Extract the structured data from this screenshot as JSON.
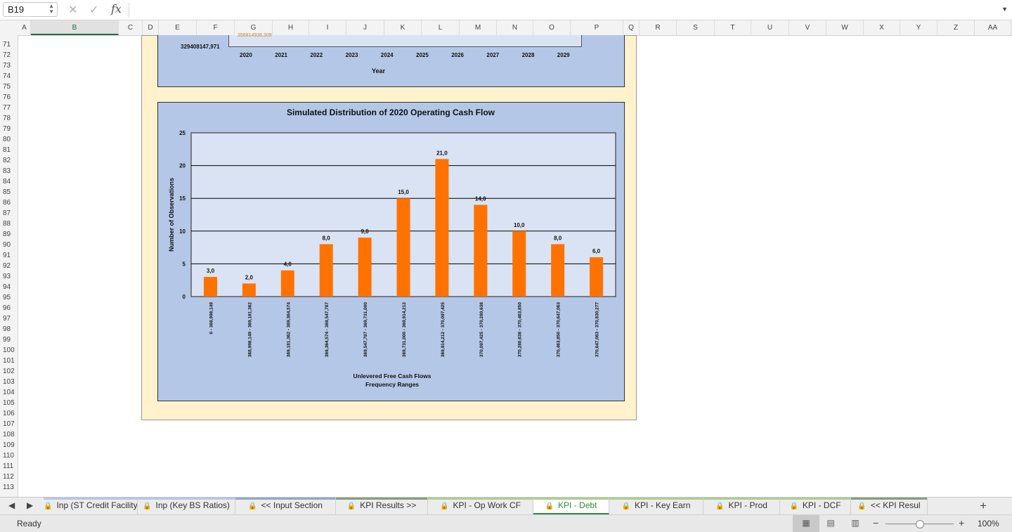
{
  "formula_bar": {
    "name_box": "B19",
    "fx_label": "fx",
    "formula": ""
  },
  "columns": [
    "A",
    "B",
    "C",
    "D",
    "E",
    "F",
    "G",
    "H",
    "I",
    "J",
    "K",
    "L",
    "M",
    "N",
    "O",
    "P",
    "Q",
    "R",
    "S",
    "T",
    "U",
    "V",
    "W",
    "X",
    "Y",
    "Z",
    "AA"
  ],
  "selected_column": "B",
  "rows": [
    "71",
    "72",
    "73",
    "74",
    "75",
    "76",
    "77",
    "78",
    "79",
    "80",
    "81",
    "82",
    "83",
    "84",
    "85",
    "86",
    "87",
    "88",
    "89",
    "90",
    "91",
    "92",
    "93",
    "94",
    "95",
    "96",
    "97",
    "98",
    "99",
    "100",
    "101",
    "102",
    "103",
    "104",
    "105",
    "106",
    "107",
    "108",
    "109",
    "110",
    "111",
    "112",
    "113"
  ],
  "top_chart": {
    "label_value": "329408147,971",
    "faint_label": "356814936,309",
    "years": [
      "2020",
      "2021",
      "2022",
      "2023",
      "2024",
      "2025",
      "2026",
      "2027",
      "2028",
      "2029"
    ],
    "x_axis_title": "Year"
  },
  "chart_data": {
    "type": "bar",
    "title": "Simulated Distribution of 2020 Operating Cash Flow",
    "ylabel": "Number of Observations",
    "xlabel_line1": "Unlevered Free Cash Flows",
    "xlabel_line2": "Frequency Ranges",
    "ylim": [
      0,
      25
    ],
    "yticks": [
      0,
      5,
      10,
      15,
      20,
      25
    ],
    "grid": true,
    "bar_color": "#ff7200",
    "categories": [
      "0 - 368,998,149",
      "368,998,149 - 369,181,362",
      "369,181,362 - 369,364,574",
      "369,364,574 - 369,547,787",
      "369,547,787 - 369,731,000",
      "369,731,000 - 369,914,212",
      "369,914,212 - 370,097,425",
      "370,097,425 - 370,280,638",
      "370,280,638 - 370,463,850",
      "370,463,850 - 370,647,063",
      "370,647,063 - 370,830,277"
    ],
    "values": [
      3,
      2,
      4,
      8,
      9,
      15,
      21,
      14,
      10,
      8,
      6
    ],
    "data_labels": [
      "3,0",
      "2,0",
      "4,0",
      "8,0",
      "9,0",
      "15,0",
      "21,0",
      "14,0",
      "10,0",
      "8,0",
      "6,0"
    ]
  },
  "tabs": [
    {
      "label": "Inp (ST Credit Facility)",
      "color": "#b4c7e7"
    },
    {
      "label": "Inp (Key BS Ratios)",
      "color": "#b4c7e7"
    },
    {
      "label": "<< Input Section",
      "color": "#8ea9c9"
    },
    {
      "label": "KPI Results >>",
      "color": "#84a07a"
    },
    {
      "label": "KPI - Op Work CF",
      "color": "#a9d08e"
    },
    {
      "label": "KPI - Debt",
      "color": "#a9d08e"
    },
    {
      "label": "KPI - Key Earn",
      "color": "#a9d08e"
    },
    {
      "label": "KPI - Prod",
      "color": "#a9d08e"
    },
    {
      "label": "KPI - DCF",
      "color": "#a9d08e"
    },
    {
      "label": "<< KPI Resul",
      "color": "#84a07a"
    }
  ],
  "active_tab": "KPI - Debt",
  "status": {
    "ready": "Ready",
    "zoom": "100%"
  }
}
